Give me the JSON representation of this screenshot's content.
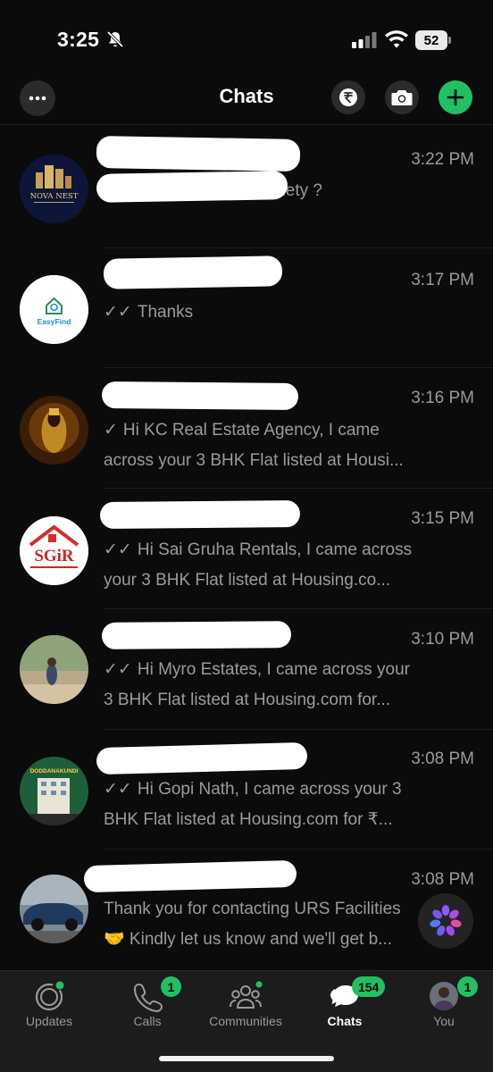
{
  "status_bar": {
    "time": "3:25",
    "battery": "52"
  },
  "header": {
    "title": "Chats"
  },
  "chats": [
    {
      "time": "3:22 PM",
      "preview_lines": [
        "society ?"
      ],
      "tick": "none",
      "avatar_text": "NOVA NEST"
    },
    {
      "time": "3:17 PM",
      "preview_lines": [
        "Thanks"
      ],
      "tick": "double",
      "avatar_text": "EasyFind"
    },
    {
      "time": "3:16 PM",
      "preview_lines": [
        "Hi KC Real Estate Agency, I came",
        "across your 3 BHK Flat listed at Housi..."
      ],
      "tick": "single"
    },
    {
      "time": "3:15 PM",
      "preview_lines": [
        "Hi Sai Gruha Rentals, I came across",
        "your 3 BHK Flat listed at Housing.co..."
      ],
      "tick": "double",
      "avatar_text": "SGiR"
    },
    {
      "time": "3:10 PM",
      "preview_lines": [
        "Hi Myro Estates, I came across your",
        "3 BHK Flat listed at Housing.com for..."
      ],
      "tick": "double"
    },
    {
      "time": "3:08 PM",
      "preview_lines": [
        "Hi Gopi Nath, I came across your 3",
        "BHK Flat listed at Housing.com for ₹..."
      ],
      "tick": "double",
      "avatar_text": "DODDANAKUNDI"
    },
    {
      "time": "3:08 PM",
      "preview_lines": [
        "Thank you for contacting URS Facilities",
        "🤝 Kindly let us know and we'll get b..."
      ],
      "tick": "none"
    }
  ],
  "tabs": [
    {
      "label": "Updates",
      "badge": ""
    },
    {
      "label": "Calls",
      "badge": "1"
    },
    {
      "label": "Communities",
      "badge": ""
    },
    {
      "label": "Chats",
      "badge": "154"
    },
    {
      "label": "You",
      "badge": "1"
    }
  ],
  "colors": {
    "accent": "#21c063",
    "background": "#0b0b0b",
    "secondary_text": "#9b9b9b"
  }
}
